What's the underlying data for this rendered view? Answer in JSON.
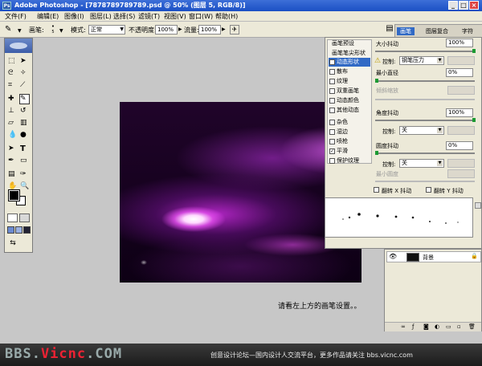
{
  "window": {
    "title": "Adobe Photoshop - [7878789789789.psd @ 50% (图层 5, RGB/8)]",
    "logo_text": "Ps",
    "minimize": "_",
    "maximize": "□",
    "close": "×"
  },
  "menu": [
    "文件(F)",
    "编辑(E)",
    "图像(I)",
    "图层(L)",
    "选择(S)",
    "滤镜(T)",
    "视图(V)",
    "窗口(W)",
    "帮助(H)"
  ],
  "options_bar": {
    "brush_label": "画笔:",
    "brush_size": "5",
    "mode_label": "模式:",
    "mode_value": "正常",
    "opacity_label": "不透明度:",
    "opacity_value": "100%",
    "flow_label": "流量:",
    "flow_value": "100%"
  },
  "palette_tabs": [
    "画笔",
    "图层复合",
    "字符"
  ],
  "brushes_panel": {
    "items": [
      {
        "label": "画笔预设",
        "checkbox": false,
        "checked": false
      },
      {
        "label": "画笔笔尖形状",
        "checkbox": false,
        "checked": false
      },
      {
        "label": "动态形状",
        "checkbox": true,
        "checked": true,
        "active": true
      },
      {
        "label": "散布",
        "checkbox": true,
        "checked": false
      },
      {
        "label": "纹理",
        "checkbox": true,
        "checked": false
      },
      {
        "label": "双重画笔",
        "checkbox": true,
        "checked": false
      },
      {
        "label": "动态颜色",
        "checkbox": true,
        "checked": false
      },
      {
        "label": "其他动态",
        "checkbox": true,
        "checked": false
      },
      {
        "label": "杂色",
        "checkbox": true,
        "checked": false
      },
      {
        "label": "湿边",
        "checkbox": true,
        "checked": false
      },
      {
        "label": "喷枪",
        "checkbox": true,
        "checked": false
      },
      {
        "label": "平滑",
        "checkbox": true,
        "checked": true
      },
      {
        "label": "保护纹理",
        "checkbox": true,
        "checked": false
      }
    ],
    "size_jitter_label": "大小抖动",
    "size_jitter_value": "100%",
    "control_label": "控制:",
    "control1_value": "钢笔压力",
    "min_diameter_label": "最小直径",
    "min_diameter_value": "0%",
    "tilt_scale_label": "倾斜缩放",
    "angle_jitter_label": "角度抖动",
    "angle_jitter_value": "100%",
    "control2_value": "关",
    "roundness_jitter_label": "圆度抖动",
    "roundness_jitter_value": "0%",
    "control3_value": "关",
    "min_roundness_label": "最小圆度",
    "flip_x_label": "翻转 X 抖动",
    "flip_y_label": "翻转 Y 抖动"
  },
  "layers_panel": {
    "layer_name": "背景"
  },
  "annotation": "请看左上方的画笔设置。。",
  "footer": {
    "logo_left": "BBS.",
    "logo_red": "Vicnc",
    "logo_right": ".COM",
    "slogan": "创意设计论坛—国内设计人交流平台，更多作品请关注 bbs.vicnc.com"
  },
  "colors": {
    "titlebar": "#1a4fc4",
    "panel_bg": "#ece9d8",
    "active_item": "#316ac5",
    "slider_knob": "#1c9a33"
  }
}
